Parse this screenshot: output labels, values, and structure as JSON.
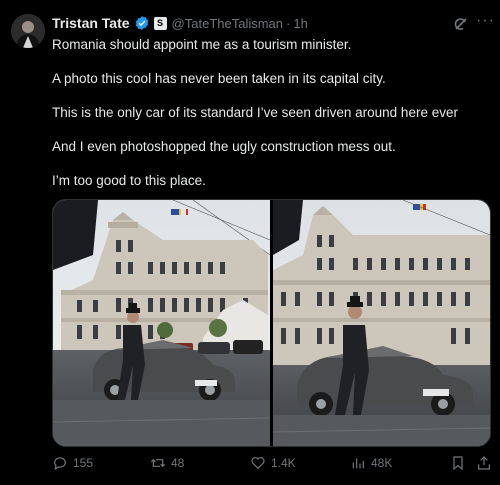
{
  "author": {
    "name": "Tristan Tate",
    "handle": "@TateTheTalisman",
    "time": "1h",
    "badge_letter": "S"
  },
  "tweet": {
    "lines": [
      "Romania should appoint me as a tourism minister.",
      "A photo this cool has never been taken in its capital city.",
      "This is the only car of its standard I’ve seen driven around here ever",
      "And I even photoshopped the ugly construction mess out.",
      "I’m too good to this place."
    ]
  },
  "media": {
    "photos": [
      {
        "plate": "M·DB 5012",
        "variant": "original"
      },
      {
        "plate": "M·DB 5012",
        "variant": "edited"
      }
    ]
  },
  "metrics": {
    "replies": "155",
    "reposts": "48",
    "likes": "1.4K",
    "views": "48K"
  },
  "icons": [
    "verified-icon",
    "grok-icon",
    "more-icon",
    "reply-icon",
    "repost-icon",
    "like-icon",
    "views-icon",
    "bookmark-icon",
    "share-icon"
  ],
  "colors": {
    "accent": "#1d9bf0",
    "muted": "#71767b",
    "text": "#e7e9ea"
  }
}
